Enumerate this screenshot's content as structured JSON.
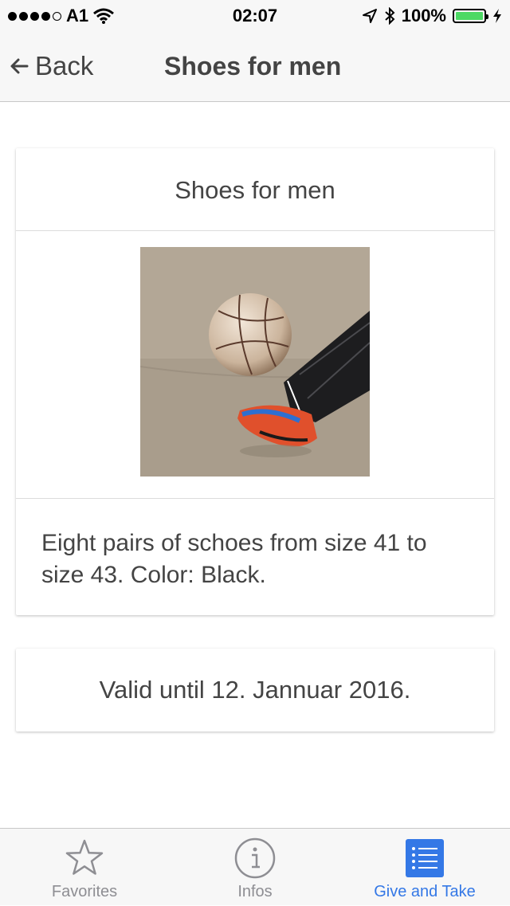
{
  "status_bar": {
    "carrier": "A1",
    "time": "02:07",
    "battery": "100%",
    "signal_filled": 4,
    "signal_total": 5
  },
  "nav": {
    "back_label": "Back",
    "title": "Shoes for men"
  },
  "card": {
    "title": "Shoes for men",
    "description": "Eight pairs of schoes from size 41 to size 43. Color: Black."
  },
  "validity": {
    "text": "Valid until 12. Jannuar 2016."
  },
  "tabs": [
    {
      "label": "Favorites",
      "icon": "star-icon",
      "active": false
    },
    {
      "label": "Infos",
      "icon": "info-icon",
      "active": false
    },
    {
      "label": "Give and Take",
      "icon": "list-icon",
      "active": true
    }
  ],
  "colors": {
    "accent": "#3478e6",
    "battery": "#4cd964",
    "inactive": "#8e8e93"
  }
}
